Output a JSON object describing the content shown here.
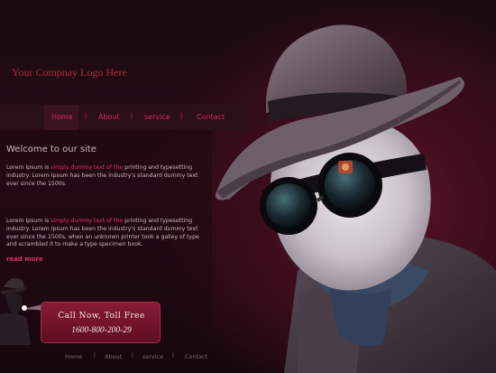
{
  "header": {
    "logo_text": "Your Compnay Logo Here"
  },
  "nav": {
    "items": [
      {
        "label": "Home",
        "active": true
      },
      {
        "label": "About",
        "active": false
      },
      {
        "label": "service",
        "active": false
      },
      {
        "label": "Contact",
        "active": false
      }
    ],
    "separator": "|"
  },
  "main": {
    "heading": "Welcome to our site",
    "para1": {
      "pre": "Lorem Ipsum is ",
      "highlight": "simply dummy text of the",
      "post": " printing and typesetting industry. Lorem Ipsum has been the industry's standard dummy text ever since the 1500s."
    },
    "para2": {
      "pre": "Lorem Ipsum is ",
      "highlight": "simply dummy text of the",
      "post": " printing and typesetting industry. Lorem Ipsum has been the industry's standard dummy text ever since the 1500s, when an unknown printer took a galley of type and scrambled it to make a type specimen book."
    },
    "read_more": "read more"
  },
  "cta": {
    "title": "Call Now, Toll Free",
    "number": "1600-800-200-29"
  },
  "footer": {
    "items": [
      "Home",
      "About",
      "service",
      "Contact"
    ],
    "separator": "|"
  },
  "colors": {
    "accent": "#e0306a",
    "logo": "#b0283f",
    "background": "#1a0b10",
    "cta_bg": "#7a1530"
  },
  "icons": [
    "spy-silhouette-icon",
    "hero-invisible-man-image"
  ]
}
